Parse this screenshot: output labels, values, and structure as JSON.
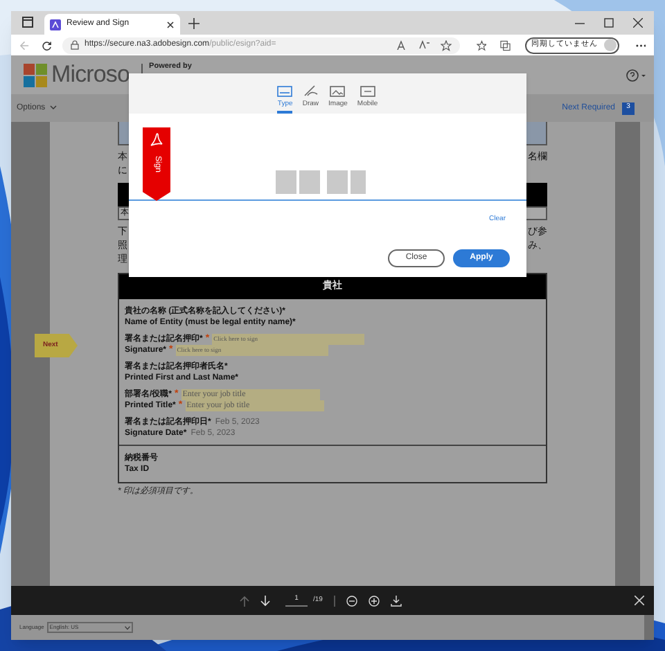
{
  "browser": {
    "tab_title": "Review and Sign",
    "url_host": "https://secure.na3.adobesign.com",
    "url_path": "/public/esign?aid=",
    "profile_label": "同期していません"
  },
  "header": {
    "company": "Microso",
    "powered_by": "Powered by"
  },
  "toolbar": {
    "options": "Options",
    "next_required": "Next Required",
    "next_count": "3"
  },
  "document": {
    "left_fragments": [
      "本",
      "に"
    ],
    "right_fragments": [
      "名欄"
    ],
    "row_fragment": "本",
    "left_fragments_2": [
      "下",
      "照",
      "理"
    ],
    "right_fragments_2": [
      "び参",
      "み、"
    ],
    "section_title": "貴社",
    "rows": [
      {
        "lines": [
          {
            "label": "貴社の名称 (正式名称を記入してください)*"
          },
          {
            "label": "Name of Entity (must be legal entity name)*"
          }
        ]
      },
      {
        "lines": [
          {
            "label": "署名または記名押印*",
            "marker": "*",
            "value": "Click here to sign",
            "kind": "signature"
          },
          {
            "label": "Signature*",
            "marker": "*",
            "value": "Click here to sign",
            "kind": "signature"
          }
        ]
      },
      {
        "lines": [
          {
            "label": "署名または記名押印者氏名*"
          },
          {
            "label": "Printed First and Last Name*"
          }
        ]
      },
      {
        "lines": [
          {
            "label": "部署名/役職*",
            "marker": "*",
            "value": "Enter your job title",
            "kind": "input"
          },
          {
            "label": "Printed Title*",
            "marker": "*",
            "value": "Enter your job title",
            "kind": "input"
          }
        ]
      },
      {
        "lines": [
          {
            "label": "署名または記名押印日*",
            "value": "Feb 5, 2023",
            "kind": "date"
          },
          {
            "label": "Signature Date*",
            "value": "Feb 5, 2023",
            "kind": "date"
          }
        ]
      }
    ],
    "tax_rows": [
      {
        "lines": [
          {
            "label": "納税番号"
          },
          {
            "label": "Tax ID"
          }
        ]
      }
    ],
    "footnote": "* 印は必須項目です。",
    "next_tag": "Next"
  },
  "modal": {
    "tabs": [
      {
        "label": "Type",
        "selected": true
      },
      {
        "label": "Draw",
        "selected": false
      },
      {
        "label": "Image",
        "selected": false
      },
      {
        "label": "Mobile",
        "selected": false
      }
    ],
    "ribbon_text": "Sign",
    "clear": "Clear",
    "buttons": [
      {
        "label": "Close",
        "kind": "secondary"
      },
      {
        "label": "Apply",
        "kind": "primary"
      }
    ]
  },
  "viewer": {
    "page": "1",
    "total": "/19"
  },
  "footer": {
    "language_label": "Language",
    "language": "English: US"
  }
}
